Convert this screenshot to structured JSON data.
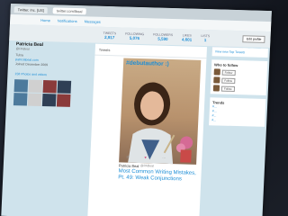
{
  "browser": {
    "tab_title": "Twitter, Inc. [US]",
    "url": "twitter.com/lbeal"
  },
  "nav": {
    "home": "Home",
    "notifications": "Notifications",
    "messages": "Messages",
    "search_placeholder": "Search Twitter",
    "tweet_button": "Tweet"
  },
  "profile": {
    "name": "Patricia Beal",
    "handle": "@PABeal",
    "location": "Tulsa",
    "website": "patriciabeal.com",
    "joined": "Joined December 2009",
    "photos_link": "158 Photos and videos"
  },
  "stats": [
    {
      "label": "TWEETS",
      "value": "2,917"
    },
    {
      "label": "FOLLOWING",
      "value": "5,076"
    },
    {
      "label": "FOLLOWERS",
      "value": "5,590"
    },
    {
      "label": "LIKES",
      "value": "4,601"
    },
    {
      "label": "LISTS",
      "value": "1"
    }
  ],
  "edit_button": "Edit profile",
  "tweet": {
    "hashtag": "#debutauthor :)",
    "author": "Patricia Beal",
    "author_handle": "@PABeal",
    "headline": "Most Common Writing Mistakes, Pt. 49: Weak Conjunctions"
  },
  "sidebar": {
    "suggestion_link": "View new Top Tweets",
    "who_title": "Who to follow",
    "who": [
      {
        "follow": "Follow"
      },
      {
        "follow": "Follow"
      },
      {
        "follow": "Follow"
      }
    ],
    "trends_title": "Trends",
    "trends": [
      "#...",
      "#...",
      "#...",
      "#..."
    ]
  }
}
